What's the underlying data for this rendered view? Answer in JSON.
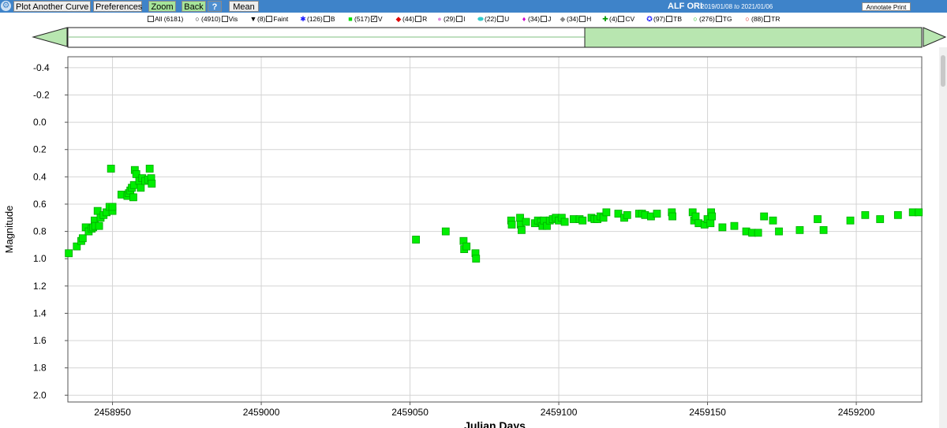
{
  "toolbar": {
    "settings_icon": "gear-icon",
    "plot_another_curve": "Plot Another Curve",
    "preferences": "Preferences",
    "zoom": "Zoom",
    "back": "Back",
    "help": "?",
    "mean": "Mean",
    "star": "ALF ORI",
    "date_from": "2019/01/08",
    "date_to": "2021/01/06",
    "date_sep": "to",
    "annotate_print": "Annotate Print"
  },
  "legend": [
    {
      "id": "all",
      "symbol": "",
      "color": "#000000",
      "label": "All (6181)",
      "checked": false,
      "prefix_checkbox": true
    },
    {
      "id": "vis",
      "symbol": "○",
      "color": "#000000",
      "label": "(4910)",
      "suffix": "Vis",
      "checked": false
    },
    {
      "id": "faint",
      "symbol": "▼",
      "color": "#000000",
      "label": "(8)",
      "suffix": "Faint",
      "checked": false
    },
    {
      "id": "b",
      "symbol": "✱",
      "color": "#1a1aff",
      "label": "(126)",
      "suffix": "B",
      "checked": false
    },
    {
      "id": "v",
      "symbol": "■",
      "color": "#00e000",
      "label": "(517)",
      "suffix": "V",
      "checked": true
    },
    {
      "id": "r",
      "symbol": "◆",
      "color": "#e00000",
      "label": "(44)",
      "suffix": "R",
      "checked": false
    },
    {
      "id": "i",
      "symbol": "●",
      "color": "#e08ae0",
      "label": "(29)",
      "suffix": "I",
      "checked": false
    },
    {
      "id": "u",
      "symbol": "⬬",
      "color": "#33cccc",
      "label": "(22)",
      "suffix": "U",
      "checked": false
    },
    {
      "id": "j",
      "symbol": "♦",
      "color": "#d000d0",
      "label": "(34)",
      "suffix": "J",
      "checked": false
    },
    {
      "id": "h",
      "symbol": "◆",
      "color": "#888888",
      "label": "(34)",
      "suffix": "H",
      "checked": false
    },
    {
      "id": "cv",
      "symbol": "✚",
      "color": "#009900",
      "label": "(4)",
      "suffix": "CV",
      "checked": false
    },
    {
      "id": "tb",
      "symbol": "✪",
      "color": "#1a1aff",
      "label": "(97)",
      "suffix": "TB",
      "checked": false
    },
    {
      "id": "tg",
      "symbol": "○",
      "color": "#00bb00",
      "label": "(276)",
      "suffix": "TG",
      "checked": false
    },
    {
      "id": "tr",
      "symbol": "○",
      "color": "#dd0000",
      "label": "(88)",
      "suffix": "TR",
      "checked": false
    }
  ],
  "slider": {
    "track_color": "#ffffff",
    "selection_color": "#b8e6b0",
    "arrow_color": "#b8e6b0",
    "border_color": "#222222"
  },
  "colors": {
    "toolbar_bg": "#3e83c9",
    "marker_fill": "#00ee00",
    "marker_stroke": "#00aa00",
    "grid": "#d4d4d4"
  },
  "chart_data": {
    "type": "scatter",
    "title": "",
    "xlabel": "Julian Days",
    "ylabel": "Magnitude",
    "xlim": [
      2458935,
      2459222
    ],
    "ylim": [
      2.05,
      -0.48
    ],
    "y_inverted": true,
    "grid": true,
    "xticks": [
      2458950,
      2459000,
      2459050,
      2459100,
      2459150,
      2459200
    ],
    "yticks": [
      -0.4,
      -0.2,
      0.0,
      0.2,
      0.4,
      0.6,
      0.8,
      1.0,
      1.2,
      1.4,
      1.6,
      1.8,
      2.0
    ],
    "series": [
      {
        "name": "V",
        "marker": "square",
        "color": "#00ee00",
        "x": [
          2458935.3,
          2458938.0,
          2458939.5,
          2458940.0,
          2458941.0,
          2458942.0,
          2458943.0,
          2458943.5,
          2458944.0,
          2458944.2,
          2458945.0,
          2458945.5,
          2458946.0,
          2458947.0,
          2458948.0,
          2458949.0,
          2458950.0,
          2458949.5,
          2458950.0,
          2458953.0,
          2458955.0,
          2458955.5,
          2458956.0,
          2458956.5,
          2458957.0,
          2458957.2,
          2458957.5,
          2458958.0,
          2458959.0,
          2458959.5,
          2458960.0,
          2458961.0,
          2458962.0,
          2458962.5,
          2458963.0,
          2458963.2,
          2459052.0,
          2459062.0,
          2459068.0,
          2459068.2,
          2459069.0,
          2459072.0,
          2459072.2,
          2459084.0,
          2459084.2,
          2459087.0,
          2459087.2,
          2459087.5,
          2459089.0,
          2459092.0,
          2459093.0,
          2459094.0,
          2459094.5,
          2459095.0,
          2459096.0,
          2459097.0,
          2459098.0,
          2459099.0,
          2459100.0,
          2459101.0,
          2459102.0,
          2459105.0,
          2459107.0,
          2459108.0,
          2459111.0,
          2459112.0,
          2459113.0,
          2459114.0,
          2459115.0,
          2459116.0,
          2459120.0,
          2459122.0,
          2459123.0,
          2459127.0,
          2459128.0,
          2459129.0,
          2459131.0,
          2459133.0,
          2459138.0,
          2459138.2,
          2459145.0,
          2459145.5,
          2459146.0,
          2459147.0,
          2459149.0,
          2459150.0,
          2459151.0,
          2459151.2,
          2459151.5,
          2459155.0,
          2459159.0,
          2459163.0,
          2459165.0,
          2459167.0,
          2459169.0,
          2459172.0,
          2459174.0,
          2459181.0,
          2459187.0,
          2459189.0,
          2459198.0,
          2459203.0,
          2459208.0,
          2459214.0,
          2459219.0,
          2459221.0
        ],
        "y": [
          0.96,
          0.91,
          0.87,
          0.85,
          0.77,
          0.8,
          0.78,
          0.77,
          0.72,
          0.76,
          0.65,
          0.76,
          0.7,
          0.68,
          0.66,
          0.62,
          0.65,
          0.34,
          0.62,
          0.53,
          0.54,
          0.52,
          0.5,
          0.48,
          0.55,
          0.46,
          0.35,
          0.38,
          0.43,
          0.48,
          0.41,
          0.43,
          0.42,
          0.34,
          0.41,
          0.45,
          0.86,
          0.8,
          0.87,
          0.93,
          0.91,
          0.96,
          1.0,
          0.72,
          0.75,
          0.7,
          0.75,
          0.79,
          0.73,
          0.74,
          0.72,
          0.73,
          0.76,
          0.72,
          0.76,
          0.72,
          0.71,
          0.7,
          0.72,
          0.7,
          0.73,
          0.71,
          0.71,
          0.72,
          0.7,
          0.71,
          0.71,
          0.69,
          0.7,
          0.66,
          0.67,
          0.7,
          0.68,
          0.67,
          0.67,
          0.68,
          0.69,
          0.67,
          0.66,
          0.69,
          0.66,
          0.72,
          0.69,
          0.74,
          0.75,
          0.71,
          0.74,
          0.66,
          0.69,
          0.77,
          0.76,
          0.8,
          0.81,
          0.81,
          0.69,
          0.72,
          0.8,
          0.79,
          0.71,
          0.79,
          0.72,
          0.68,
          0.71,
          0.68,
          0.66,
          0.66
        ]
      }
    ]
  }
}
